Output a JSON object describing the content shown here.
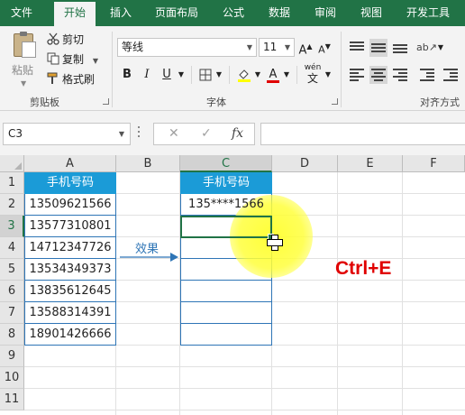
{
  "ribbon": {
    "tabs": [
      "文件",
      "开始",
      "插入",
      "页面布局",
      "公式",
      "数据",
      "审阅",
      "视图",
      "开发工具"
    ],
    "active_tab": "开始",
    "clipboard": {
      "paste": "粘贴",
      "cut": "剪切",
      "copy": "复制",
      "format_painter": "格式刷",
      "group_label": "剪贴板"
    },
    "font": {
      "name": "等线",
      "size": "11",
      "bold": "B",
      "italic": "I",
      "underline": "U",
      "group_label": "字体",
      "phonetic_top": "wén",
      "phonetic_char": "文"
    },
    "alignment": {
      "group_label": "对齐方式"
    }
  },
  "formula_bar": {
    "name_box": "C3",
    "formula": ""
  },
  "sheet": {
    "columns": [
      "A",
      "B",
      "C",
      "D",
      "E",
      "F"
    ],
    "selected_column": "C",
    "rows": [
      "1",
      "2",
      "3",
      "4",
      "5",
      "6",
      "7",
      "8",
      "9",
      "10",
      "11"
    ],
    "selected_row": "3",
    "column_a_header": "手机号码",
    "column_a_values": [
      "13509621566",
      "13577310801",
      "14712347726",
      "13534349373",
      "13835612645",
      "13588314391",
      "18901426666"
    ],
    "column_c_header": "手机号码",
    "column_c_values": [
      "135****1566",
      "",
      "",
      "",
      "",
      "",
      ""
    ],
    "active_cell": "C3"
  },
  "annotations": {
    "effect_label": "效果",
    "shortcut": "Ctrl+E",
    "arrow_color": "#2e75b6",
    "shortcut_color": "#e00000",
    "highlight_color": "#ffff33"
  },
  "theme": {
    "accent": "#217346",
    "header_fill": "#1b9bd7"
  }
}
